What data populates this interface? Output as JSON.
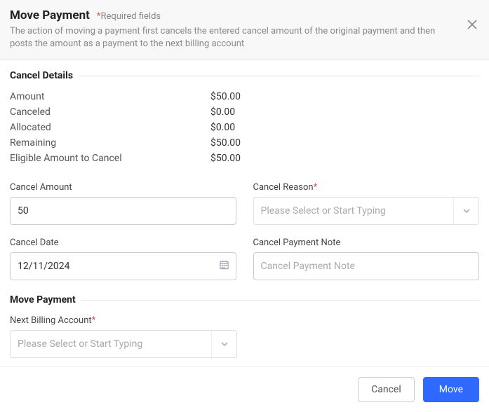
{
  "header": {
    "title": "Move Payment",
    "required_hint": "Required fields",
    "description": "The action of moving a payment first cancels the entered cancel amount of the original payment and then posts the amount as a payment to the next billing account"
  },
  "sections": {
    "cancel_details": "Cancel Details",
    "move_payment": "Move Payment"
  },
  "details": [
    {
      "label": "Amount",
      "value": "$50.00"
    },
    {
      "label": "Canceled",
      "value": "$0.00"
    },
    {
      "label": "Allocated",
      "value": "$0.00"
    },
    {
      "label": "Remaining",
      "value": "$50.00"
    },
    {
      "label": "Eligible Amount to Cancel",
      "value": "$50.00"
    }
  ],
  "fields": {
    "cancel_amount": {
      "label": "Cancel Amount",
      "value": "50"
    },
    "cancel_reason": {
      "label": "Cancel Reason",
      "placeholder": "Please Select or Start Typing"
    },
    "cancel_date": {
      "label": "Cancel Date",
      "value": "12/11/2024"
    },
    "cancel_note": {
      "label": "Cancel Payment Note",
      "placeholder": "Cancel Payment Note"
    },
    "next_billing_account": {
      "label": "Next Billing Account",
      "placeholder": "Please Select or Start Typing"
    }
  },
  "footer": {
    "cancel": "Cancel",
    "move": "Move"
  }
}
